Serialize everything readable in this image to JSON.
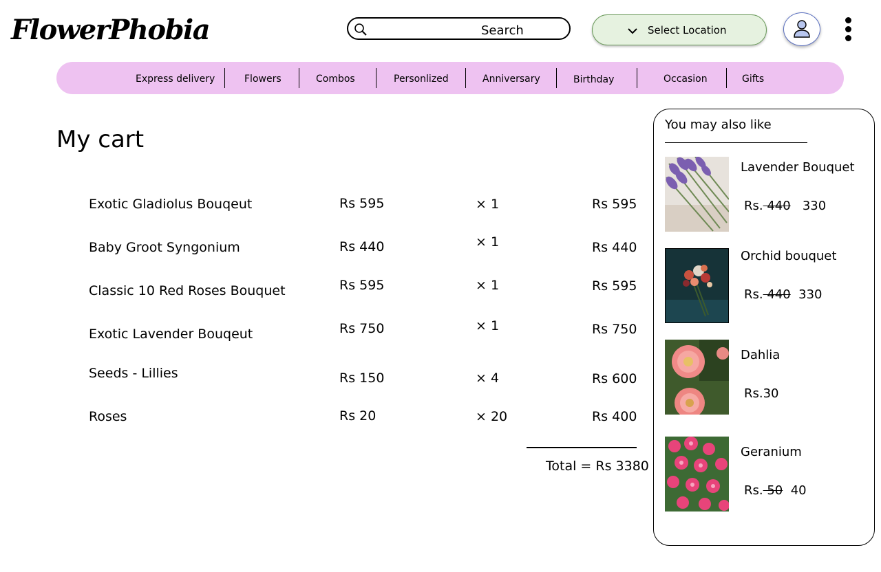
{
  "header": {
    "logo": "FlowerPhobia",
    "search_label": "Search",
    "location_label": "Select Location"
  },
  "nav": {
    "items": [
      "Express delivery",
      "Flowers",
      "Combos",
      "Personlized",
      "Anniversary",
      "Birthday",
      "Occasion",
      "Gifts"
    ]
  },
  "cart": {
    "title": "My cart",
    "items": [
      {
        "name": "Exotic Gladiolus Bouqeut",
        "price": "Rs 595",
        "qty": "× 1",
        "subtotal": "Rs 595"
      },
      {
        "name": "Baby Groot Syngonium",
        "price": "Rs 440",
        "qty": "× 1",
        "subtotal": "Rs 440"
      },
      {
        "name": "Classic 10 Red Roses Bouquet",
        "price": "Rs 595",
        "qty": "× 1",
        "subtotal": "Rs 595"
      },
      {
        "name": "Exotic Lavender Bouqeut",
        "price": "Rs 750",
        "qty": "× 1",
        "subtotal": "Rs 750"
      },
      {
        "name": "Seeds - Lillies",
        "price": "Rs 150",
        "qty": "× 4",
        "subtotal": "Rs 600"
      },
      {
        "name": "Roses",
        "price": "Rs 20",
        "qty": "× 20",
        "subtotal": "Rs 400"
      }
    ],
    "total": "Total = Rs 3380"
  },
  "suggestions": {
    "title": "You may also like",
    "items": [
      {
        "name": "Lavender Bouquet",
        "currency": "Rs.",
        "old_price": " 440",
        "price": "330"
      },
      {
        "name": "Orchid bouquet",
        "currency": "Rs.",
        "old_price": " 440",
        "price": "330"
      },
      {
        "name": "Dahlia",
        "currency": "Rs.",
        "old_price": "",
        "price": "30"
      },
      {
        "name": "Geranium",
        "currency": "Rs.",
        "old_price": " 50",
        "price": "40"
      }
    ]
  },
  "colors": {
    "nav_bg": "#eec2f1",
    "location_bg": "#e6f2e0",
    "avatar_fill": "#b8c6ee"
  },
  "icons": [
    "search-icon",
    "chevron-down-icon",
    "user-icon",
    "more-vertical-icon"
  ]
}
